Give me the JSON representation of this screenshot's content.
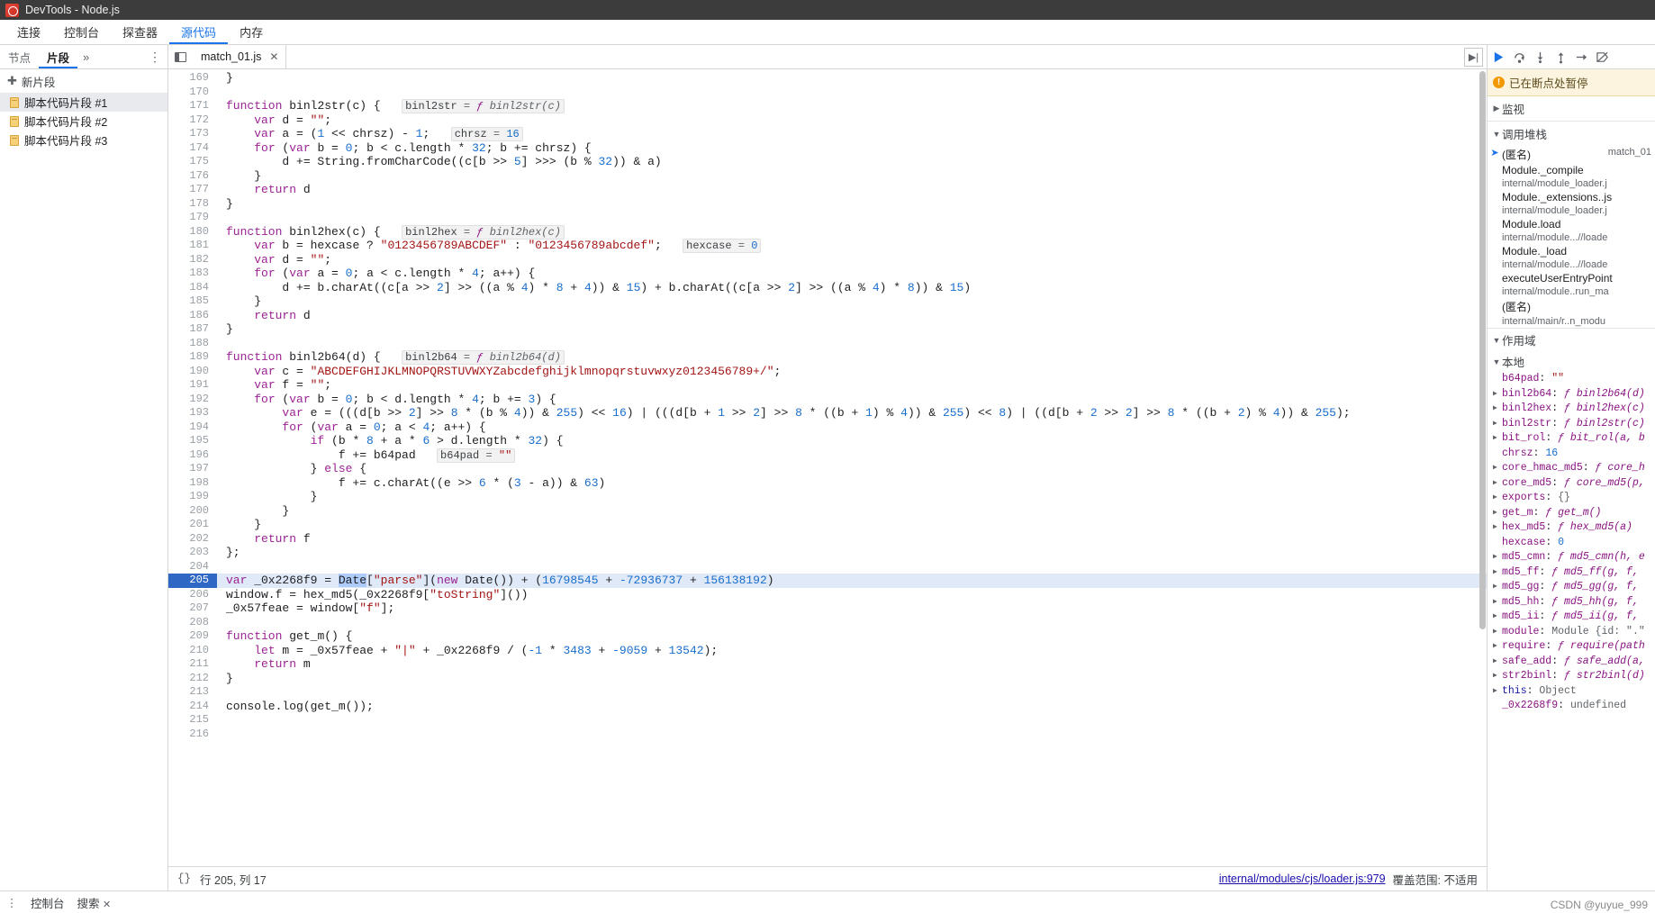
{
  "window": {
    "title": "DevTools - Node.js",
    "logo_icon": "devtools-logo-icon"
  },
  "menubar": {
    "items": [
      {
        "label": "连接",
        "active": false
      },
      {
        "label": "控制台",
        "active": false
      },
      {
        "label": "探查器",
        "active": false
      },
      {
        "label": "源代码",
        "active": true
      },
      {
        "label": "内存",
        "active": false
      }
    ]
  },
  "left_panel": {
    "tabs": [
      {
        "label": "节点",
        "active": false
      },
      {
        "label": "片段",
        "active": true
      }
    ],
    "more_icon": "chevron-right-icon",
    "menu_icon": "more-vertical-icon",
    "new_snippet": {
      "label": "新片段",
      "plus": "+"
    },
    "snippets": [
      {
        "label": "脚本代码片段 #1",
        "selected": true
      },
      {
        "label": "脚本代码片段 #2",
        "selected": false
      },
      {
        "label": "脚本代码片段 #3",
        "selected": false
      }
    ]
  },
  "editor": {
    "panel_toggle_icon": "show-navigator-icon",
    "tabs": [
      {
        "label": "match_01.js",
        "close": "✕",
        "active": true
      }
    ],
    "right_button_icon": "show-debugger-icon",
    "first_line": 169,
    "lines": [
      {
        "n": 169,
        "text": "}"
      },
      {
        "n": 170,
        "text": ""
      },
      {
        "n": 171,
        "text": "function binl2str(c) {",
        "inline": "binl2str = ƒ binl2str(c)"
      },
      {
        "n": 172,
        "text": "    var d = \"\";"
      },
      {
        "n": 173,
        "text": "    var a = (1 << chrsz) - 1;",
        "inline": "chrsz = 16"
      },
      {
        "n": 174,
        "text": "    for (var b = 0; b < c.length * 32; b += chrsz) {"
      },
      {
        "n": 175,
        "text": "        d += String.fromCharCode((c[b >> 5] >>> (b % 32)) & a)"
      },
      {
        "n": 176,
        "text": "    }"
      },
      {
        "n": 177,
        "text": "    return d"
      },
      {
        "n": 178,
        "text": "}"
      },
      {
        "n": 179,
        "text": ""
      },
      {
        "n": 180,
        "text": "function binl2hex(c) {",
        "inline": "binl2hex = ƒ binl2hex(c)"
      },
      {
        "n": 181,
        "text": "    var b = hexcase ? \"0123456789ABCDEF\" : \"0123456789abcdef\";",
        "inline": "hexcase = 0"
      },
      {
        "n": 182,
        "text": "    var d = \"\";"
      },
      {
        "n": 183,
        "text": "    for (var a = 0; a < c.length * 4; a++) {"
      },
      {
        "n": 184,
        "text": "        d += b.charAt((c[a >> 2] >> ((a % 4) * 8 + 4)) & 15) + b.charAt((c[a >> 2] >> ((a % 4) * 8)) & 15)"
      },
      {
        "n": 185,
        "text": "    }"
      },
      {
        "n": 186,
        "text": "    return d"
      },
      {
        "n": 187,
        "text": "}"
      },
      {
        "n": 188,
        "text": ""
      },
      {
        "n": 189,
        "text": "function binl2b64(d) {",
        "inline": "binl2b64 = ƒ binl2b64(d)"
      },
      {
        "n": 190,
        "text": "    var c = \"ABCDEFGHIJKLMNOPQRSTUVWXYZabcdefghijklmnopqrstuvwxyz0123456789+/\";"
      },
      {
        "n": 191,
        "text": "    var f = \"\";"
      },
      {
        "n": 192,
        "text": "    for (var b = 0; b < d.length * 4; b += 3) {"
      },
      {
        "n": 193,
        "text": "        var e = (((d[b >> 2] >> 8 * (b % 4)) & 255) << 16) | (((d[b + 1 >> 2] >> 8 * ((b + 1) % 4)) & 255) << 8) | ((d[b + 2 >> 2] >> 8 * ((b + 2) % 4)) & 255);"
      },
      {
        "n": 194,
        "text": "        for (var a = 0; a < 4; a++) {"
      },
      {
        "n": 195,
        "text": "            if (b * 8 + a * 6 > d.length * 32) {"
      },
      {
        "n": 196,
        "text": "                f += b64pad",
        "inline": "b64pad = \"\""
      },
      {
        "n": 197,
        "text": "            } else {"
      },
      {
        "n": 198,
        "text": "                f += c.charAt((e >> 6 * (3 - a)) & 63)"
      },
      {
        "n": 199,
        "text": "            }"
      },
      {
        "n": 200,
        "text": "        }"
      },
      {
        "n": 201,
        "text": "    }"
      },
      {
        "n": 202,
        "text": "    return f"
      },
      {
        "n": 203,
        "text": "};"
      },
      {
        "n": 204,
        "text": ""
      },
      {
        "n": 205,
        "text": "var _0x2268f9 = Date[\"parse\"](new Date()) + (16798545 + -72936737 + 156138192)",
        "highlight": true
      },
      {
        "n": 206,
        "text": "window.f = hex_md5(_0x2268f9[\"toString\"]())"
      },
      {
        "n": 207,
        "text": "_0x57feae = window[\"f\"];"
      },
      {
        "n": 208,
        "text": ""
      },
      {
        "n": 209,
        "text": "function get_m() {"
      },
      {
        "n": 210,
        "text": "    let m = _0x57feae + \"|\" + _0x2268f9 / (-1 * 3483 + -9059 + 13542);"
      },
      {
        "n": 211,
        "text": "    return m"
      },
      {
        "n": 212,
        "text": "}"
      },
      {
        "n": 213,
        "text": ""
      },
      {
        "n": 214,
        "text": "console.log(get_m());"
      },
      {
        "n": 215,
        "text": ""
      },
      {
        "n": 216,
        "text": ""
      }
    ],
    "status": {
      "braces_icon": "format-braces-icon",
      "position": "行 205, 列 17",
      "source_link": "internal/modules/cjs/loader.js:979",
      "coverage": "覆盖范围: 不适用"
    }
  },
  "debugger": {
    "toolbar_buttons": [
      {
        "icon": "resume-icon",
        "name": "resume-script-button"
      },
      {
        "icon": "step-over-icon",
        "name": "step-over-button"
      },
      {
        "icon": "step-into-icon",
        "name": "step-into-button"
      },
      {
        "icon": "step-out-icon",
        "name": "step-out-button"
      },
      {
        "icon": "step-icon",
        "name": "step-button"
      },
      {
        "icon": "deactivate-breakpoints-icon",
        "name": "deactivate-breakpoints-button"
      }
    ],
    "paused_banner": {
      "icon": "info-icon",
      "text": "已在断点处暂停"
    },
    "sections": [
      {
        "label": "监视",
        "expanded": false
      },
      {
        "label": "调用堆栈",
        "expanded": true
      },
      {
        "label": "作用域",
        "expanded": true
      }
    ],
    "call_stack": [
      {
        "name": "(匿名)",
        "sub": "",
        "file": "match_01",
        "current": true
      },
      {
        "name": "Module._compile",
        "sub": "internal/module_loader.j",
        "file": ""
      },
      {
        "name": "Module._extensions..js",
        "sub": "internal/module_loader.j",
        "file": ""
      },
      {
        "name": "Module.load",
        "sub": "internal/module...//loade",
        "file": ""
      },
      {
        "name": "Module._load",
        "sub": "internal/module...//loade",
        "file": ""
      },
      {
        "name": "executeUserEntryPoint",
        "sub": "internal/module..run_ma",
        "file": ""
      },
      {
        "name": "(匿名)",
        "sub": "internal/main/r..n_modu",
        "file": ""
      }
    ],
    "scope_label": "本地",
    "variables": [
      {
        "expand": false,
        "name": "b64pad",
        "value": "\"\"",
        "kind": "str"
      },
      {
        "expand": true,
        "name": "binl2b64",
        "value": "ƒ binl2b64(d)",
        "kind": "fn"
      },
      {
        "expand": true,
        "name": "binl2hex",
        "value": "ƒ binl2hex(c)",
        "kind": "fn"
      },
      {
        "expand": true,
        "name": "binl2str",
        "value": "ƒ binl2str(c)",
        "kind": "fn"
      },
      {
        "expand": true,
        "name": "bit_rol",
        "value": "ƒ bit_rol(a, b",
        "kind": "fn"
      },
      {
        "expand": false,
        "name": "chrsz",
        "value": "16",
        "kind": "num"
      },
      {
        "expand": true,
        "name": "core_hmac_md5",
        "value": "ƒ core_h",
        "kind": "fn"
      },
      {
        "expand": true,
        "name": "core_md5",
        "value": "ƒ core_md5(p,",
        "kind": "fn"
      },
      {
        "expand": true,
        "name": "exports",
        "value": "{}",
        "kind": "grey"
      },
      {
        "expand": true,
        "name": "get_m",
        "value": "ƒ get_m()",
        "kind": "fn"
      },
      {
        "expand": true,
        "name": "hex_md5",
        "value": "ƒ hex_md5(a)",
        "kind": "fn"
      },
      {
        "expand": false,
        "name": "hexcase",
        "value": "0",
        "kind": "num"
      },
      {
        "expand": true,
        "name": "md5_cmn",
        "value": "ƒ md5_cmn(h, e",
        "kind": "fn"
      },
      {
        "expand": true,
        "name": "md5_ff",
        "value": "ƒ md5_ff(g, f,",
        "kind": "fn"
      },
      {
        "expand": true,
        "name": "md5_gg",
        "value": "ƒ md5_gg(g, f,",
        "kind": "fn"
      },
      {
        "expand": true,
        "name": "md5_hh",
        "value": "ƒ md5_hh(g, f,",
        "kind": "fn"
      },
      {
        "expand": true,
        "name": "md5_ii",
        "value": "ƒ md5_ii(g, f,",
        "kind": "fn"
      },
      {
        "expand": true,
        "name": "module",
        "value": "Module {id: \".\"",
        "kind": "grey"
      },
      {
        "expand": true,
        "name": "require",
        "value": "ƒ require(path",
        "kind": "fn"
      },
      {
        "expand": true,
        "name": "safe_add",
        "value": "ƒ safe_add(a,",
        "kind": "fn"
      },
      {
        "expand": true,
        "name": "str2binl",
        "value": "ƒ str2binl(d)",
        "kind": "fn"
      },
      {
        "expand": true,
        "name": "this",
        "value": "Object",
        "kind": "grey"
      },
      {
        "expand": false,
        "name": "_0x2268f9",
        "value": "undefined",
        "kind": "grey"
      }
    ]
  },
  "bottom_bar": {
    "menu_icon": "more-vertical-icon",
    "items": [
      {
        "label": "控制台"
      },
      {
        "label": "搜索",
        "closable": true
      }
    ],
    "close_icon": "✕"
  },
  "watermark": "CSDN @yuyue_999",
  "colors": {
    "accent": "#1a73e8",
    "titlebar": "#3c3c3c",
    "highlight_line": "#dfe9f8",
    "selection": "#aecbfa",
    "pause_banner": "#fdf4e0"
  }
}
